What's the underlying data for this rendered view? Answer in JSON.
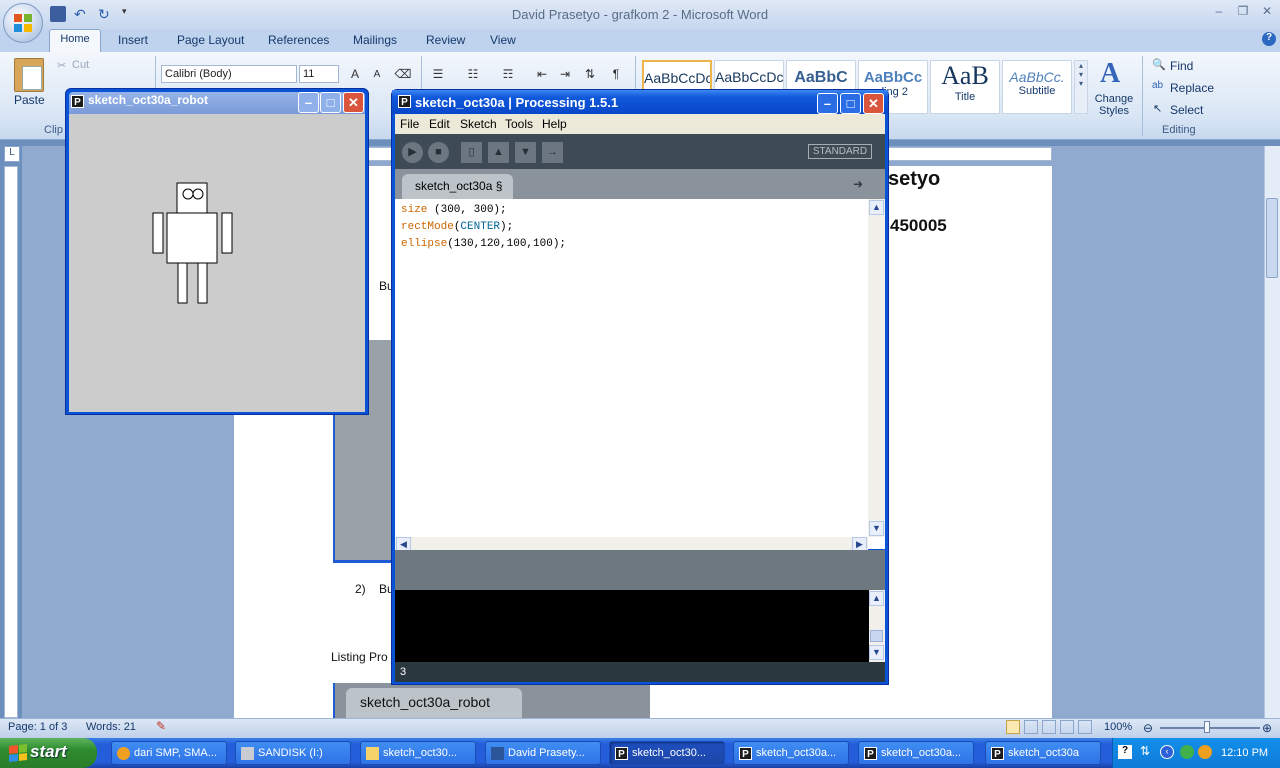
{
  "word": {
    "title": "David Prasetyo - grafkom 2 - Microsoft Word",
    "tabs": [
      "Home",
      "Insert",
      "Page Layout",
      "References",
      "Mailings",
      "Review",
      "View"
    ],
    "clipboard": {
      "paste": "Paste",
      "cut": "Cut",
      "group": "Clip"
    },
    "font": {
      "name": "Calibri (Body)",
      "size": "11"
    },
    "styles": [
      {
        "sample": "AaBbCcDc",
        "name": ""
      },
      {
        "sample": "AaBbCcDc",
        "name": ""
      },
      {
        "sample": "AaBbC",
        "name": ""
      },
      {
        "sample": "AaBbCc",
        "name": "ding 2"
      },
      {
        "sample": "AaB",
        "name": "Title"
      },
      {
        "sample": "AaBbCc.",
        "name": "Subtitle"
      }
    ],
    "change_styles": "Change Styles",
    "editing": {
      "find": "Find",
      "replace": "Replace",
      "select": "Select",
      "group": "Editing"
    },
    "doc": {
      "heading_fragment": "setyo",
      "number_fragment": "450005",
      "b_fragment_1": "Bu",
      "item_number": "2)",
      "b_fragment_2": "Bu",
      "listing": "Listing Pro",
      "embedded_tab": "sketch_oct30a_robot"
    },
    "status": {
      "page": "Page: 1 of 3",
      "words": "Words: 21",
      "zoom": "100%"
    }
  },
  "robot_window": {
    "title": "sketch_oct30a_robot"
  },
  "processing": {
    "title": "sketch_oct30a | Processing 1.5.1",
    "menu": [
      "File",
      "Edit",
      "Sketch",
      "Tools",
      "Help"
    ],
    "mode": "STANDARD",
    "tab": "sketch_oct30a §",
    "line_number": "3",
    "code": [
      {
        "fn": "size",
        "rest": " (300, 300);"
      },
      {
        "fn": "rectMode",
        "open": "(",
        "const": "CENTER",
        "rest": ");"
      },
      {
        "fn": "ellipse",
        "rest": "(130,120,100,100);"
      }
    ]
  },
  "taskbar": {
    "start": "start",
    "tasks": [
      {
        "label": "dari SMP, SMA...",
        "active": false
      },
      {
        "label": "SANDISK (I:)",
        "active": false
      },
      {
        "label": "sketch_oct30...",
        "active": false
      },
      {
        "label": "David Prasety...",
        "active": false
      },
      {
        "label": "sketch_oct30...",
        "active": true
      },
      {
        "label": "sketch_oct30a...",
        "active": false
      },
      {
        "label": "sketch_oct30a...",
        "active": false
      },
      {
        "label": "sketch_oct30a",
        "active": false
      }
    ],
    "clock": "12:10 PM"
  },
  "colors": {
    "xp_blue": "#0a52d6",
    "processing_toolbar": "#3e4a54",
    "keyword": "#cc6600",
    "constant": "#006699"
  }
}
